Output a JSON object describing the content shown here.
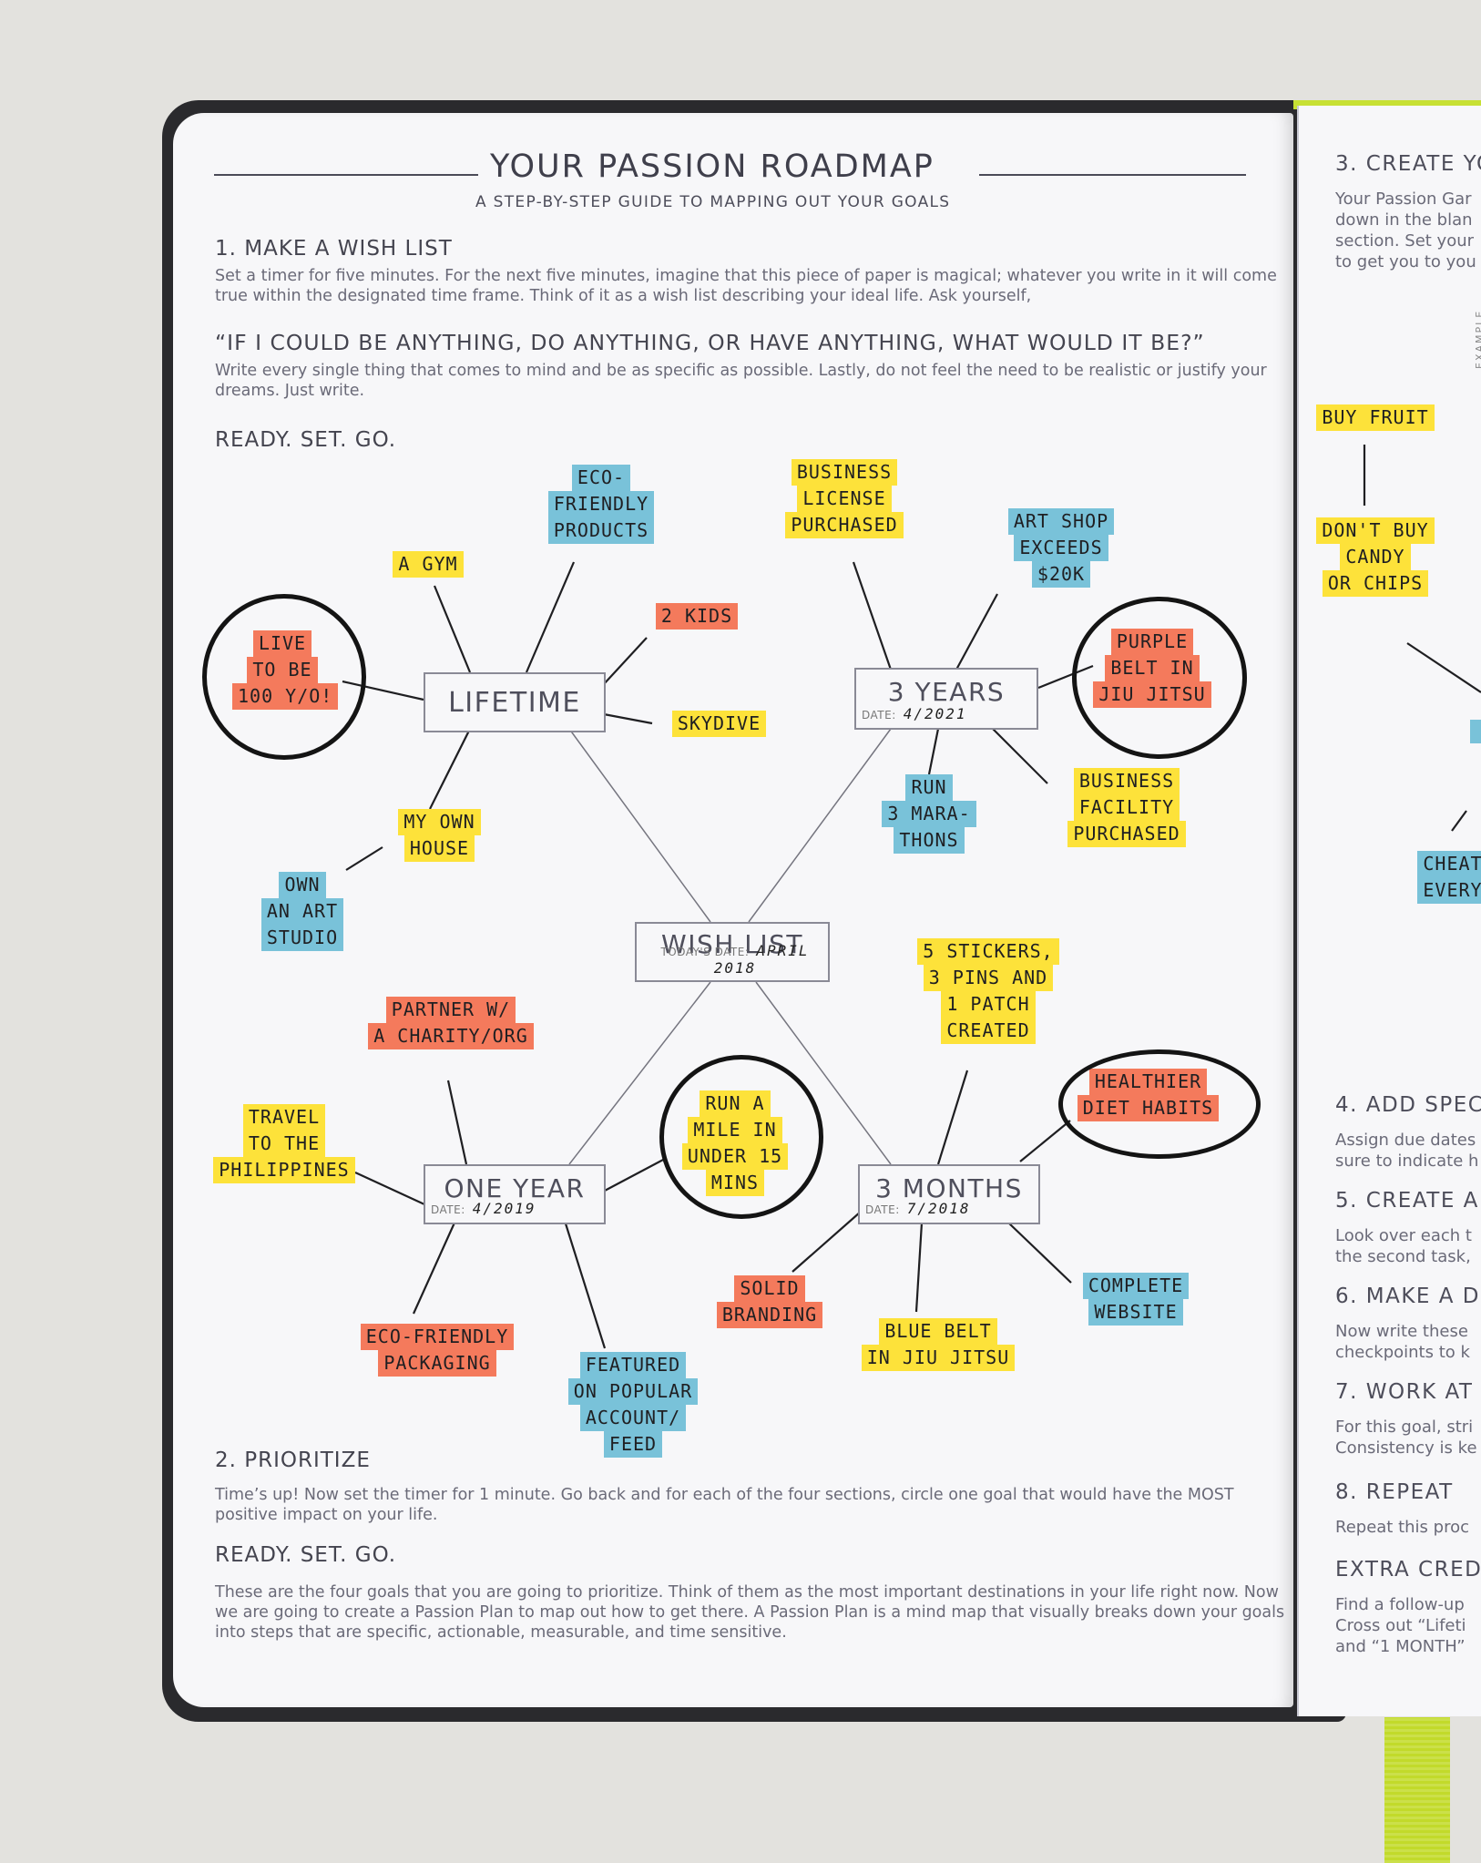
{
  "page": {
    "title": "YOUR PASSION ROADMAP",
    "subtitle": "A STEP-BY-STEP GUIDE TO MAPPING OUT YOUR GOALS",
    "step1": {
      "heading": "1. MAKE A WISH LIST",
      "body": "Set a timer for five minutes. For the next five minutes, imagine that this piece of paper is magical; whatever you write in it will come true within the designated time frame. Think of it as a wish list describing your ideal life. Ask yourself,",
      "quote": "“IF I COULD BE ANYTHING, DO ANYTHING, OR HAVE ANYTHING, WHAT WOULD IT BE?”",
      "body2": "Write every single thing that comes to mind and be as specific as possible. Lastly, do not feel the need to be realistic or justify your dreams. Just write.",
      "cta": "READY. SET. GO."
    },
    "step2": {
      "heading": "2. PRIORITIZE",
      "body": "Time’s up! Now set the timer for 1 minute. Go back and for each of the four sections, circle one goal that would have the MOST positive impact on your life.",
      "cta": "READY. SET. GO.",
      "body2": "These are the four goals that you are going to prioritize. Think of them as the most important destinations in your life right now. Now we are going to create a Passion Plan to map out how to get there. A Passion Plan is a mind map that visually breaks down your goals into steps that are specific, actionable, measurable, and time sensitive."
    }
  },
  "mindmap": {
    "center": {
      "title": "WISH LIST",
      "date_label": "TODAY'S DATE:",
      "date": "APRIL 2018"
    },
    "lifetime": {
      "title": "LIFETIME"
    },
    "three_years": {
      "title": "3 YEARS",
      "date_label": "DATE:",
      "date": "4/2021"
    },
    "one_year": {
      "title": "ONE YEAR",
      "date_label": "DATE:",
      "date": "4/2019"
    },
    "three_months": {
      "title": "3 MONTHS",
      "date_label": "DATE:",
      "date": "7/2018"
    },
    "goals": {
      "live_100": [
        "LIVE",
        "TO BE",
        "100 Y/O!"
      ],
      "gym": [
        "A GYM"
      ],
      "eco_products": [
        "ECO-",
        "FRIENDLY",
        "PRODUCTS"
      ],
      "two_kids": [
        "2 KIDS"
      ],
      "skydive": [
        "SKYDIVE"
      ],
      "own_house": [
        "MY OWN",
        "HOUSE"
      ],
      "art_studio": [
        "OWN",
        "AN ART",
        "STUDIO"
      ],
      "business_license": [
        "BUSINESS",
        "LICENSE",
        "PURCHASED"
      ],
      "art_shop": [
        "ART SHOP",
        "EXCEEDS",
        "$20K"
      ],
      "purple_belt": [
        "PURPLE",
        "BELT IN",
        "JIU JITSU"
      ],
      "marathons": [
        "RUN",
        "3 MARA-",
        "THONS"
      ],
      "business_facility": [
        "BUSINESS",
        "FACILITY",
        "PURCHASED"
      ],
      "charity": [
        "PARTNER W/",
        "A CHARITY/ORG"
      ],
      "philippines": [
        "TRAVEL",
        "TO THE",
        "PHILIPPINES"
      ],
      "run_mile": [
        "RUN A",
        "MILE IN",
        "UNDER 15",
        "MINS"
      ],
      "eco_packaging": [
        "ECO-FRIENDLY",
        "PACKAGING"
      ],
      "featured": [
        "FEATURED",
        "ON POPULAR",
        "ACCOUNT/",
        "FEED"
      ],
      "stickers": [
        "5 STICKERS,",
        "3 PINS AND",
        "1 PATCH",
        "CREATED"
      ],
      "healthier_diet": [
        "HEALTHIER",
        "DIET HABITS"
      ],
      "solid_branding": [
        "SOLID",
        "BRANDING"
      ],
      "blue_belt": [
        "BLUE BELT",
        "IN JIU JITSU"
      ],
      "complete_website": [
        "COMPLETE",
        "WEBSITE"
      ]
    }
  },
  "right_page": {
    "vertical_label": "EXAMPLE",
    "step3": {
      "heading": "3. CREATE YO",
      "lines": [
        "Your Passion Gar",
        "down in the blan",
        "section. Set your",
        "to get you to you"
      ]
    },
    "example_goals": {
      "buy_fruit": [
        "BUY FRUIT"
      ],
      "no_candy": [
        "DON'T BUY",
        "CANDY",
        "OR CHIPS"
      ],
      "cheat": [
        "CHEAT",
        "EVERY"
      ]
    },
    "steps": [
      {
        "heading": "4. ADD SPEC",
        "lines": [
          "Assign due dates",
          "sure to indicate h"
        ]
      },
      {
        "heading": "5. CREATE A",
        "lines": [
          "Look over each t",
          "the second task,"
        ]
      },
      {
        "heading": "6. MAKE A D",
        "lines": [
          "Now write these",
          "checkpoints to k"
        ]
      },
      {
        "heading": "7. WORK AT",
        "lines": [
          "For this goal, stri",
          "Consistency is ke"
        ]
      },
      {
        "heading": "8. REPEAT",
        "lines": [
          "Repeat this proc"
        ]
      },
      {
        "heading": "EXTRA CRED",
        "lines": [
          "Find a follow-up",
          "Cross out “Lifeti",
          "and “1 MONTH”"
        ]
      }
    ]
  },
  "colors": {
    "highlight_yellow": "#fde23a",
    "highlight_blue": "#79c2d9",
    "highlight_red": "#f47a5c",
    "ribbon_green": "#c2da2a"
  }
}
